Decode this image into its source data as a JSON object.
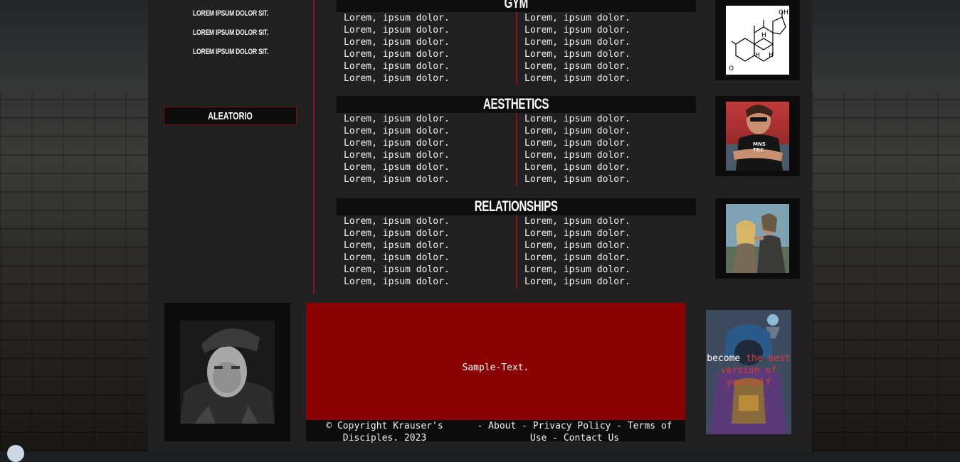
{
  "nav": {
    "links": [
      "LOREM IPSUM DOLOR SIT.",
      "LOREM IPSUM DOLOR SIT.",
      "LOREM IPSUM DOLOR SIT."
    ],
    "random_button": "ALEATORIO"
  },
  "sections": [
    {
      "title": "GYM",
      "left": [
        "Lorem, ipsum dolor.",
        "Lorem, ipsum dolor.",
        "Lorem, ipsum dolor.",
        "Lorem, ipsum dolor.",
        "Lorem, ipsum dolor.",
        "Lorem, ipsum dolor."
      ],
      "right": [
        "Lorem, ipsum dolor.",
        "Lorem, ipsum dolor.",
        "Lorem, ipsum dolor.",
        "Lorem, ipsum dolor.",
        "Lorem, ipsum dolor.",
        "Lorem, ipsum dolor."
      ]
    },
    {
      "title": "AESTHETICS",
      "left": [
        "Lorem, ipsum dolor.",
        "Lorem, ipsum dolor.",
        "Lorem, ipsum dolor.",
        "Lorem, ipsum dolor.",
        "Lorem, ipsum dolor.",
        "Lorem, ipsum dolor."
      ],
      "right": [
        "Lorem, ipsum dolor.",
        "Lorem, ipsum dolor.",
        "Lorem, ipsum dolor.",
        "Lorem, ipsum dolor.",
        "Lorem, ipsum dolor.",
        "Lorem, ipsum dolor."
      ]
    },
    {
      "title": "RELATIONSHIPS",
      "left": [
        "Lorem, ipsum dolor.",
        "Lorem, ipsum dolor.",
        "Lorem, ipsum dolor.",
        "Lorem, ipsum dolor.",
        "Lorem, ipsum dolor.",
        "Lorem, ipsum dolor."
      ],
      "right": [
        "Lorem, ipsum dolor.",
        "Lorem, ipsum dolor.",
        "Lorem, ipsum dolor.",
        "Lorem, ipsum dolor.",
        "Lorem, ipsum dolor.",
        "Lorem, ipsum dolor."
      ]
    }
  ],
  "molecule_labels": {
    "oh": "OH",
    "o": "O",
    "h1": "H",
    "h2": "H",
    "h3": "H"
  },
  "shirt_text": {
    "line1": "MNS",
    "line2": "TRC"
  },
  "main_box_text": "Sample-Text.",
  "footer": {
    "copyright": "© Copyright Krauser's Disciples. 2023",
    "links": [
      "About",
      "Privacy Policy",
      "Terms of Use",
      "Contact Us"
    ],
    "separator": " - "
  },
  "promo": {
    "white": "become ",
    "red": "the best version of yourself"
  },
  "colors": {
    "accent_red": "#8b0000",
    "rule_red": "#8e1313",
    "panel": "#212121",
    "dark": "#0c0c0c"
  }
}
